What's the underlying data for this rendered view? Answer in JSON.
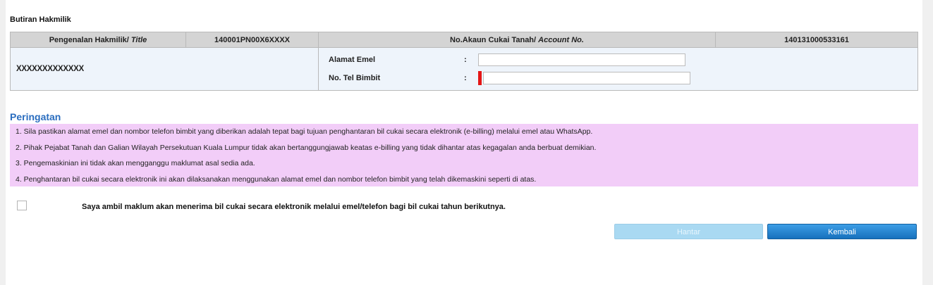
{
  "section": {
    "title": "Butiran Hakmilik"
  },
  "table": {
    "title_label": "Pengenalan Hakmilik/",
    "title_label_italic": "Title",
    "title_value": "140001PN00X6XXXX",
    "account_label": "No.Akaun Cukai Tanah/",
    "account_label_italic": "Account No.",
    "account_value": "140131000533161",
    "owner_name": "XXXXXXXXXXXXX"
  },
  "form": {
    "email_label": "Alamat Emel",
    "email_value": "",
    "phone_label": "No. Tel Bimbit",
    "phone_value": "",
    "colon": ":"
  },
  "warning": {
    "title": "Peringatan",
    "items": [
      "1. Sila pastikan alamat emel dan nombor telefon bimbit yang diberikan adalah tepat bagi tujuan penghantaran bil cukai secara elektronik (e-billing) melalui emel atau WhatsApp.",
      "2. Pihak Pejabat Tanah dan Galian Wilayah Persekutuan Kuala Lumpur tidak akan bertanggungjawab keatas e-billing yang tidak dihantar atas kegagalan anda berbuat demikian.",
      "3. Pengemaskinian ini tidak akan mengganggu maklumat asal sedia ada.",
      "4. Penghantaran bil cukai secara elektronik ini akan dilaksanakan menggunakan alamat emel dan nombor telefon bimbit yang telah dikemaskini seperti di atas."
    ]
  },
  "agreement": {
    "text": "Saya ambil maklum akan menerima bil cukai secara elektronik melalui emel/telefon bagi bil cukai tahun berikutnya.",
    "checked": false
  },
  "buttons": {
    "submit_label": "Hantar",
    "back_label": "Kembali"
  },
  "colors": {
    "warning_bg": "#f2cdf8",
    "header_bg": "#d4d4d4",
    "row_bg": "#eef4fb",
    "accent": "#2a6dbf",
    "required_mark": "#e41616"
  }
}
